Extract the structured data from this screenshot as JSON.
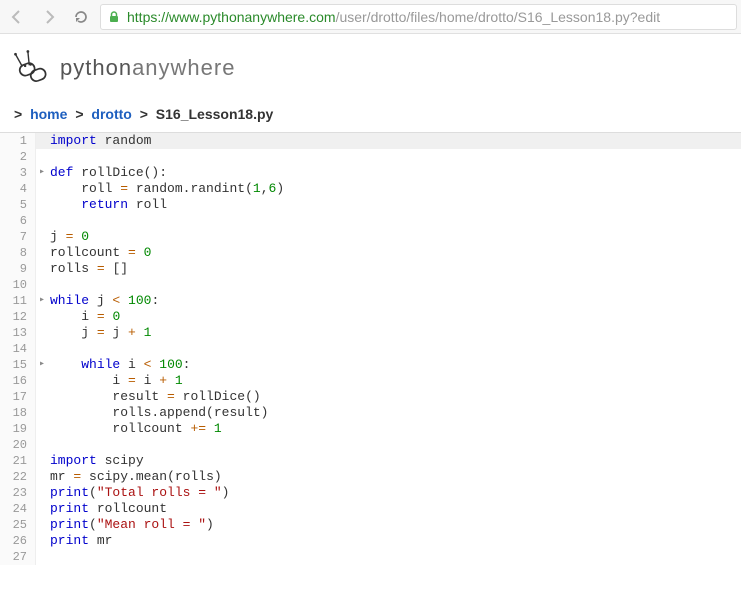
{
  "browser": {
    "url_scheme": "https",
    "url_host": "://www.pythonanywhere.com",
    "url_path": "/user/drotto/files/home/drotto/S16_Lesson18.py?edit"
  },
  "logo": {
    "py": "python",
    "any": "anywhere"
  },
  "breadcrumb": {
    "home": "home",
    "user": "drotto",
    "file": "S16_Lesson18.py"
  },
  "lines": [
    {
      "n": "1",
      "fold": "",
      "active": true,
      "tokens": [
        [
          "kw",
          "import"
        ],
        [
          "nm",
          " random"
        ]
      ]
    },
    {
      "n": "2",
      "fold": "",
      "tokens": []
    },
    {
      "n": "3",
      "fold": "▸",
      "tokens": [
        [
          "kw",
          "def"
        ],
        [
          "nm",
          " rollDice"
        ],
        [
          "pn",
          "():"
        ]
      ]
    },
    {
      "n": "4",
      "fold": "",
      "tokens": [
        [
          "nm",
          "    roll "
        ],
        [
          "op",
          "="
        ],
        [
          "nm",
          " random"
        ],
        [
          "pn",
          "."
        ],
        [
          "nm",
          "randint"
        ],
        [
          "pn",
          "("
        ],
        [
          "num",
          "1"
        ],
        [
          "pn",
          ","
        ],
        [
          "num",
          "6"
        ],
        [
          "pn",
          ")"
        ]
      ]
    },
    {
      "n": "5",
      "fold": "",
      "tokens": [
        [
          "nm",
          "    "
        ],
        [
          "kw",
          "return"
        ],
        [
          "nm",
          " roll"
        ]
      ]
    },
    {
      "n": "6",
      "fold": "",
      "tokens": []
    },
    {
      "n": "7",
      "fold": "",
      "tokens": [
        [
          "nm",
          "j "
        ],
        [
          "op",
          "="
        ],
        [
          "nm",
          " "
        ],
        [
          "num",
          "0"
        ]
      ]
    },
    {
      "n": "8",
      "fold": "",
      "tokens": [
        [
          "nm",
          "rollcount "
        ],
        [
          "op",
          "="
        ],
        [
          "nm",
          " "
        ],
        [
          "num",
          "0"
        ]
      ]
    },
    {
      "n": "9",
      "fold": "",
      "tokens": [
        [
          "nm",
          "rolls "
        ],
        [
          "op",
          "="
        ],
        [
          "nm",
          " "
        ],
        [
          "pn",
          "[]"
        ]
      ]
    },
    {
      "n": "10",
      "fold": "",
      "tokens": []
    },
    {
      "n": "11",
      "fold": "▸",
      "tokens": [
        [
          "kw",
          "while"
        ],
        [
          "nm",
          " j "
        ],
        [
          "op",
          "<"
        ],
        [
          "nm",
          " "
        ],
        [
          "num",
          "100"
        ],
        [
          "pn",
          ":"
        ]
      ]
    },
    {
      "n": "12",
      "fold": "",
      "tokens": [
        [
          "nm",
          "    i "
        ],
        [
          "op",
          "="
        ],
        [
          "nm",
          " "
        ],
        [
          "num",
          "0"
        ]
      ]
    },
    {
      "n": "13",
      "fold": "",
      "tokens": [
        [
          "nm",
          "    j "
        ],
        [
          "op",
          "="
        ],
        [
          "nm",
          " j "
        ],
        [
          "op",
          "+"
        ],
        [
          "nm",
          " "
        ],
        [
          "num",
          "1"
        ]
      ]
    },
    {
      "n": "14",
      "fold": "",
      "tokens": []
    },
    {
      "n": "15",
      "fold": "▸",
      "tokens": [
        [
          "nm",
          "    "
        ],
        [
          "kw",
          "while"
        ],
        [
          "nm",
          " i "
        ],
        [
          "op",
          "<"
        ],
        [
          "nm",
          " "
        ],
        [
          "num",
          "100"
        ],
        [
          "pn",
          ":"
        ]
      ]
    },
    {
      "n": "16",
      "fold": "",
      "tokens": [
        [
          "nm",
          "        i "
        ],
        [
          "op",
          "="
        ],
        [
          "nm",
          " i "
        ],
        [
          "op",
          "+"
        ],
        [
          "nm",
          " "
        ],
        [
          "num",
          "1"
        ]
      ]
    },
    {
      "n": "17",
      "fold": "",
      "tokens": [
        [
          "nm",
          "        result "
        ],
        [
          "op",
          "="
        ],
        [
          "nm",
          " rollDice"
        ],
        [
          "pn",
          "()"
        ]
      ]
    },
    {
      "n": "18",
      "fold": "",
      "tokens": [
        [
          "nm",
          "        rolls"
        ],
        [
          "pn",
          "."
        ],
        [
          "nm",
          "append"
        ],
        [
          "pn",
          "("
        ],
        [
          "nm",
          "result"
        ],
        [
          "pn",
          ")"
        ]
      ]
    },
    {
      "n": "19",
      "fold": "",
      "tokens": [
        [
          "nm",
          "        rollcount "
        ],
        [
          "op",
          "+="
        ],
        [
          "nm",
          " "
        ],
        [
          "num",
          "1"
        ]
      ]
    },
    {
      "n": "20",
      "fold": "",
      "tokens": []
    },
    {
      "n": "21",
      "fold": "",
      "tokens": [
        [
          "kw",
          "import"
        ],
        [
          "nm",
          " scipy"
        ]
      ]
    },
    {
      "n": "22",
      "fold": "",
      "tokens": [
        [
          "nm",
          "mr "
        ],
        [
          "op",
          "="
        ],
        [
          "nm",
          " scipy"
        ],
        [
          "pn",
          "."
        ],
        [
          "nm",
          "mean"
        ],
        [
          "pn",
          "("
        ],
        [
          "nm",
          "rolls"
        ],
        [
          "pn",
          ")"
        ]
      ]
    },
    {
      "n": "23",
      "fold": "",
      "tokens": [
        [
          "kw",
          "print"
        ],
        [
          "pn",
          "("
        ],
        [
          "str",
          "\"Total rolls = \""
        ],
        [
          "pn",
          ")"
        ]
      ]
    },
    {
      "n": "24",
      "fold": "",
      "tokens": [
        [
          "kw",
          "print"
        ],
        [
          "nm",
          " rollcount"
        ]
      ]
    },
    {
      "n": "25",
      "fold": "",
      "tokens": [
        [
          "kw",
          "print"
        ],
        [
          "pn",
          "("
        ],
        [
          "str",
          "\"Mean roll = \""
        ],
        [
          "pn",
          ")"
        ]
      ]
    },
    {
      "n": "26",
      "fold": "",
      "tokens": [
        [
          "kw",
          "print"
        ],
        [
          "nm",
          " mr"
        ]
      ]
    },
    {
      "n": "27",
      "fold": "",
      "tokens": []
    }
  ]
}
